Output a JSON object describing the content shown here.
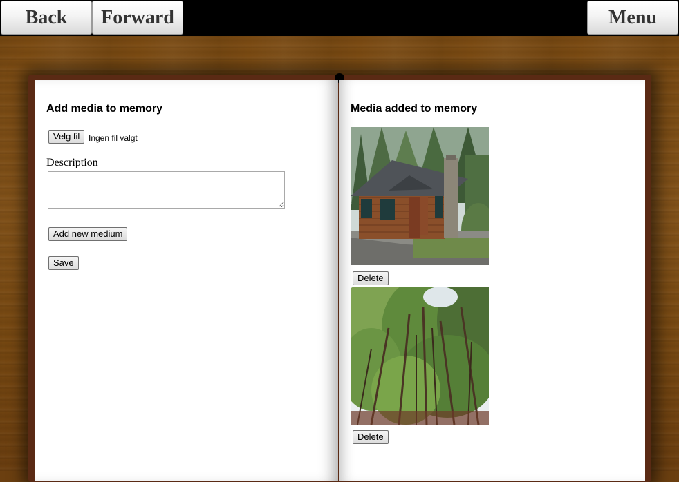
{
  "nav": {
    "back": "Back",
    "forward": "Forward",
    "menu": "Menu"
  },
  "left_page": {
    "heading": "Add media to memory",
    "file_button": "Velg fil",
    "file_status": "Ingen fil valgt",
    "description_label": "Description",
    "description_value": "",
    "add_button": "Add new medium",
    "save_button": "Save"
  },
  "right_page": {
    "heading": "Media added to memory",
    "media": [
      {
        "subject": "cabin-in-forest",
        "delete_label": "Delete"
      },
      {
        "subject": "forest-canopy",
        "delete_label": "Delete"
      }
    ]
  },
  "colors": {
    "topbar": "#000000",
    "wood": "#7a4a12",
    "book_cover": "#5a2a14",
    "page": "#ffffff"
  }
}
